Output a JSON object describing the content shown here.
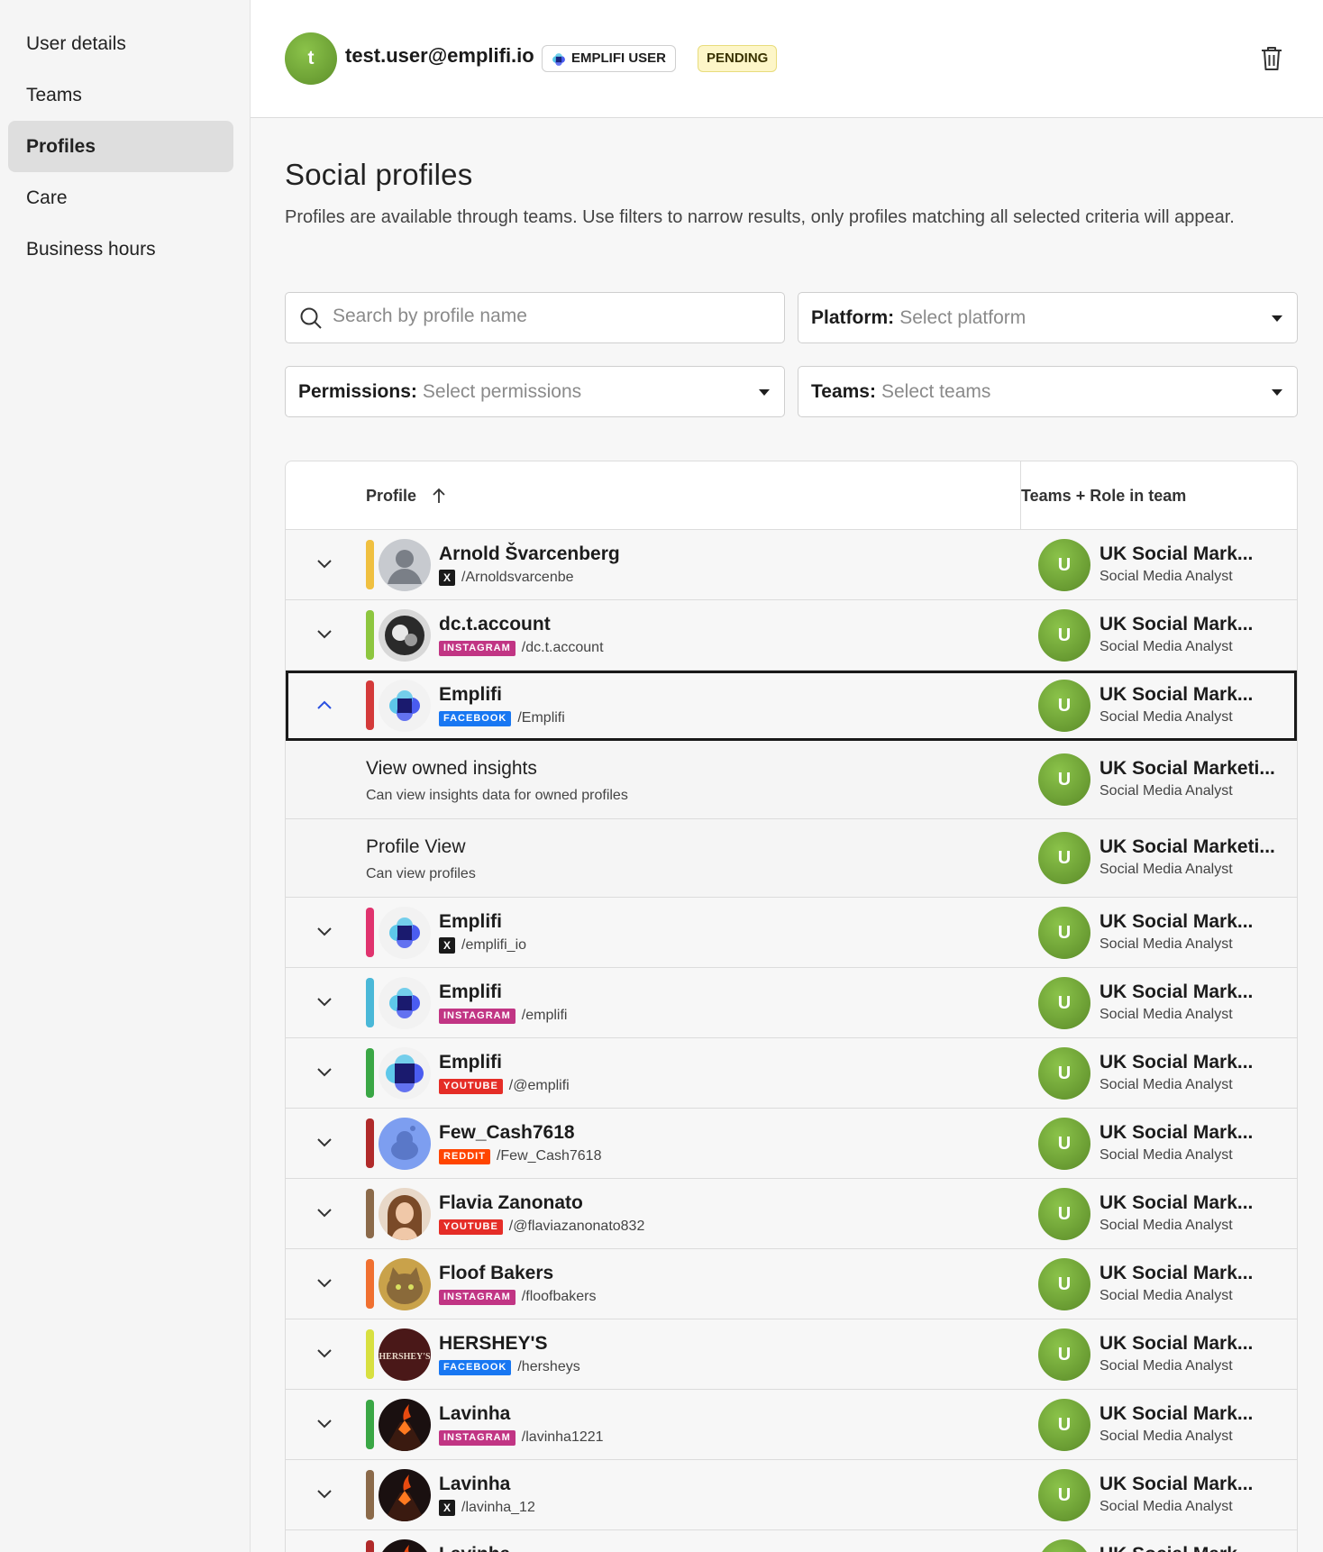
{
  "sidebar": {
    "items": [
      {
        "label": "User details",
        "active": false
      },
      {
        "label": "Teams",
        "active": false
      },
      {
        "label": "Profiles",
        "active": true
      },
      {
        "label": "Care",
        "active": false
      },
      {
        "label": "Business hours",
        "active": false
      }
    ]
  },
  "header": {
    "avatar_letter": "t",
    "email": "test.user@emplifi.io",
    "user_badge": "EMPLIFI USER",
    "status_badge": "PENDING"
  },
  "page": {
    "title": "Social profiles",
    "description": "Profiles are available through teams. Use filters to narrow results, only profiles matching all selected criteria will appear."
  },
  "filters": {
    "search_placeholder": "Search by profile name",
    "platform_label": "Platform:",
    "platform_placeholder": "Select platform",
    "permissions_label": "Permissions:",
    "permissions_placeholder": "Select permissions",
    "teams_label": "Teams:",
    "teams_placeholder": "Select teams"
  },
  "table": {
    "col_profile": "Profile",
    "col_teams": "Teams + Role in team",
    "rows": [
      {
        "name": "Arnold Švarcenberg",
        "platform": "X",
        "handle": "/Arnoldsvarcenbe",
        "color": "#f0c040",
        "avatar": "person",
        "team": "UK Social Mark...",
        "role": "Social Media Analyst",
        "team_letter": "U"
      },
      {
        "name": "dc.t.account",
        "platform": "INSTAGRAM",
        "handle": "/dc.t.account",
        "color": "#8dc63f",
        "avatar": "bw",
        "team": "UK Social Mark...",
        "role": "Social Media Analyst",
        "team_letter": "U"
      },
      {
        "name": "Emplifi",
        "platform": "FACEBOOK",
        "handle": "/Emplifi",
        "color": "#d43a3a",
        "avatar": "emplifi",
        "team": "UK Social Mark...",
        "role": "Social Media Analyst",
        "team_letter": "U",
        "expanded": true
      },
      {
        "sub": true,
        "title": "View owned insights",
        "desc": "Can view insights data for owned profiles",
        "team": "UK Social Marketi...",
        "role": "Social Media Analyst",
        "team_letter": "U"
      },
      {
        "sub": true,
        "title": "Profile View",
        "desc": "Can view profiles",
        "team": "UK Social Marketi...",
        "role": "Social Media Analyst",
        "team_letter": "U"
      },
      {
        "name": "Emplifi",
        "platform": "X",
        "handle": "/emplifi_io",
        "color": "#e0336e",
        "avatar": "emplifi",
        "team": "UK Social Mark...",
        "role": "Social Media Analyst",
        "team_letter": "U"
      },
      {
        "name": "Emplifi",
        "platform": "INSTAGRAM",
        "handle": "/emplifi",
        "color": "#4ab8d8",
        "avatar": "emplifi",
        "team": "UK Social Mark...",
        "role": "Social Media Analyst",
        "team_letter": "U"
      },
      {
        "name": "Emplifi",
        "platform": "YOUTUBE",
        "handle": "/@emplifi",
        "color": "#3aa745",
        "avatar": "emplifi-big",
        "team": "UK Social Mark...",
        "role": "Social Media Analyst",
        "team_letter": "U"
      },
      {
        "name": "Few_Cash7618",
        "platform": "REDDIT",
        "handle": "/Few_Cash7618",
        "color": "#b02a2a",
        "avatar": "reddit",
        "team": "UK Social Mark...",
        "role": "Social Media Analyst",
        "team_letter": "U"
      },
      {
        "name": "Flavia Zanonato",
        "platform": "YOUTUBE",
        "handle": "/@flaviazanonato832",
        "color": "#8b6a4a",
        "avatar": "portrait",
        "team": "UK Social Mark...",
        "role": "Social Media Analyst",
        "team_letter": "U"
      },
      {
        "name": "Floof Bakers",
        "platform": "INSTAGRAM",
        "handle": "/floofbakers",
        "color": "#f07030",
        "avatar": "cat",
        "team": "UK Social Mark...",
        "role": "Social Media Analyst",
        "team_letter": "U"
      },
      {
        "name": "HERSHEY'S",
        "platform": "FACEBOOK",
        "handle": "/hersheys",
        "color": "#d8e040",
        "avatar": "hersheys",
        "team": "UK Social Mark...",
        "role": "Social Media Analyst",
        "team_letter": "U"
      },
      {
        "name": "Lavinha",
        "platform": "INSTAGRAM",
        "handle": "/lavinha1221",
        "color": "#3aa745",
        "avatar": "volcano",
        "team": "UK Social Mark...",
        "role": "Social Media Analyst",
        "team_letter": "U"
      },
      {
        "name": "Lavinha",
        "platform": "X",
        "handle": "/lavinha_12",
        "color": "#8b6a4a",
        "avatar": "volcano",
        "team": "UK Social Mark...",
        "role": "Social Media Analyst",
        "team_letter": "U"
      },
      {
        "name": "Lavinha",
        "platform": "",
        "handle": "",
        "color": "#b02a2a",
        "avatar": "volcano",
        "team": "UK Social Mark...",
        "role": "",
        "team_letter": "U"
      }
    ]
  },
  "colors": {
    "instagram": "#c13584",
    "facebook": "#1877f2",
    "youtube": "#e52d27",
    "reddit": "#ff4500",
    "team_avatar": "#6a9e30"
  }
}
